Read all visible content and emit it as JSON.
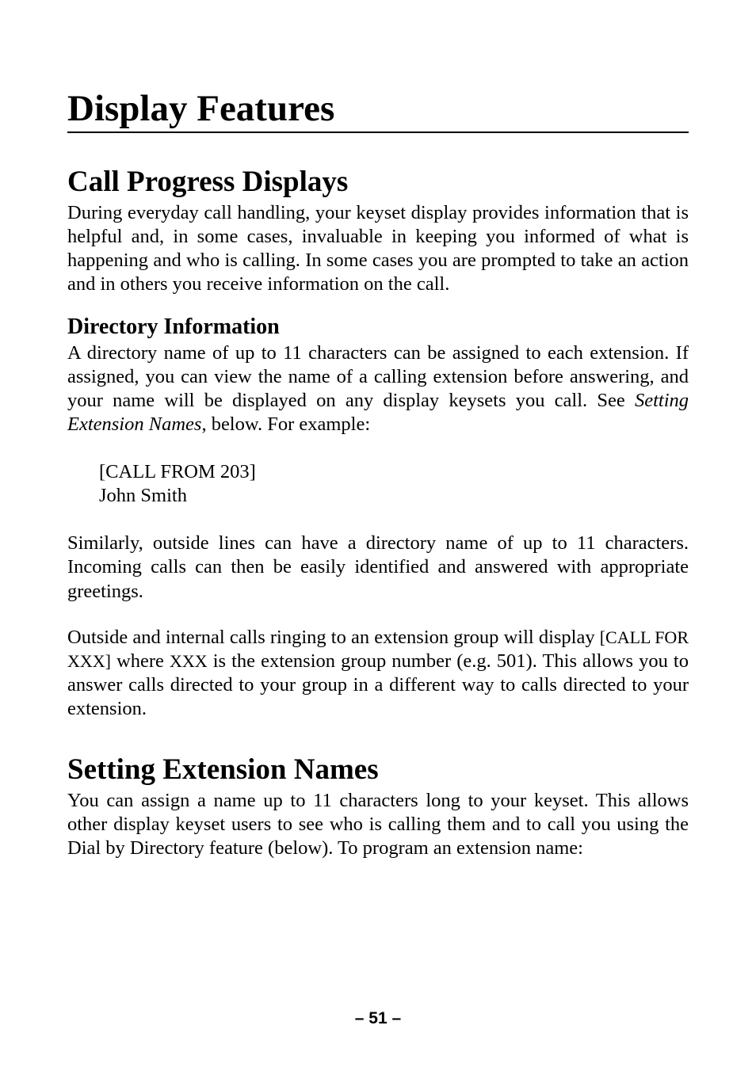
{
  "chapter": {
    "title": "Display Features"
  },
  "section1": {
    "title": "Call Progress Displays",
    "para1": "During everyday call handling, your keyset display provides information that is helpful and, in some cases, invaluable in keeping you informed of what is happening and who is calling. In some cases you are prompted to take an action and in others you receive information on the call.",
    "subsection": {
      "title": "Directory Information",
      "para1_a": "A directory name of up to 11 characters can be assigned to each extension. If assigned, you can view the name of a calling extension before answering, and your name will be displayed on any display keysets you call. See ",
      "para1_italic": "Setting Extension Names",
      "para1_b": ", below. For example:",
      "example_line1": "[CALL FROM 203]",
      "example_line2": "John Smith",
      "para2": "Similarly, outside lines can have a directory name of up to 11 characters. Incoming calls can then be easily identified and answered with appropriate greetings.",
      "para3_a": "Outside and internal calls ringing to an extension group will display ",
      "para3_sc1": "[CALL FOR XXX]",
      "para3_b": " where ",
      "para3_sc2": "XXX",
      "para3_c": " is the extension group number (e.g. 501). This allows you to answer calls directed to your group in a different way to calls directed to your extension."
    }
  },
  "section2": {
    "title": "Setting Extension Names",
    "para1": "You can assign a name up to 11 characters long to your keyset. This allows other display keyset users to see who is calling them and to call you using the Dial by Directory feature (below). To program an extension name:"
  },
  "pagenum": "– 51 –"
}
